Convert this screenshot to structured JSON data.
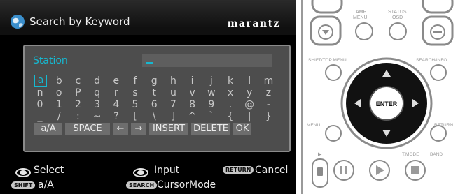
{
  "screen": {
    "title": "Search by Keyword",
    "brand": "marantz",
    "field_label": "Station",
    "keyboard_rows": [
      [
        "a",
        "b",
        "c",
        "d",
        "e",
        "f",
        "g",
        "h",
        "i",
        "j",
        "k",
        "l",
        "m"
      ],
      [
        "n",
        "o",
        "P",
        "q",
        "r",
        "s",
        "t",
        "u",
        "v",
        "w",
        "x",
        "y",
        "z"
      ],
      [
        "0",
        "1",
        "2",
        "3",
        "4",
        "5",
        "6",
        "7",
        "8",
        "9",
        ".",
        "@",
        "-"
      ],
      [
        "_",
        "/",
        ":",
        "~",
        "?",
        "[",
        "\\",
        "]",
        "^",
        "`",
        "{",
        "|",
        "}"
      ]
    ],
    "selected_key": "a",
    "controls": [
      "a/A",
      "SPACE",
      "←",
      "→",
      "INSERT",
      "DELETE",
      "OK"
    ]
  },
  "footer": {
    "select": "Select",
    "input": "Input",
    "return_badge": "RETURN",
    "cancel": "Cancel",
    "shift_badge": "SHIFT",
    "shift_action": "a/A",
    "search_badge": "SEARCH",
    "cursor_mode": "CursorMode"
  },
  "remote": {
    "amp_menu": "AMP MENU",
    "status_osd": "STATUS OSD",
    "shift_top_menu": "SHIFT/TOP MENU",
    "search_info": "SEARCH/INFO",
    "enter": "ENTER",
    "menu": "MENU",
    "return": "RETURN",
    "tmode": "T.MODE",
    "band": "BAND"
  }
}
